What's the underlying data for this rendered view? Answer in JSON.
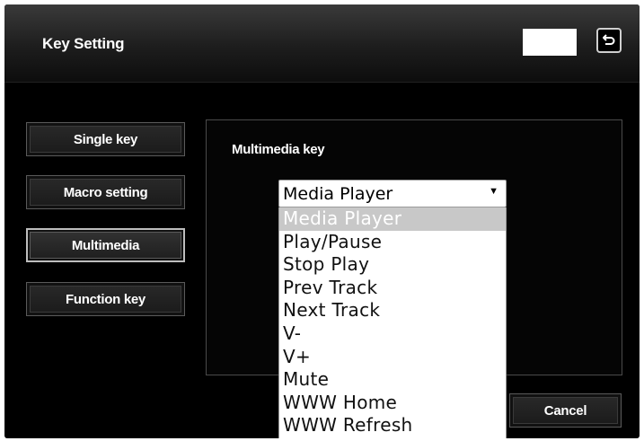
{
  "header": {
    "title": "Key Setting",
    "back_icon": "return-arrow-icon"
  },
  "sidebar": {
    "items": [
      {
        "label": "Single key",
        "active": false
      },
      {
        "label": "Macro setting",
        "active": false
      },
      {
        "label": "Multimedia",
        "active": true
      },
      {
        "label": "Function key",
        "active": false
      }
    ]
  },
  "panel": {
    "label": "Multimedia key",
    "select": {
      "value": "Media Player",
      "options": [
        "Media Player",
        "Play/Pause",
        "Stop Play",
        "Prev Track",
        "Next Track",
        "V-",
        "V+",
        "Mute",
        "WWW Home",
        "WWW Refresh"
      ],
      "highlighted_index": 0
    }
  },
  "footer": {
    "cancel_label": "Cancel"
  },
  "colors": {
    "background": "#000000",
    "text": "#ffffff",
    "highlight": "#c8c8c8"
  }
}
